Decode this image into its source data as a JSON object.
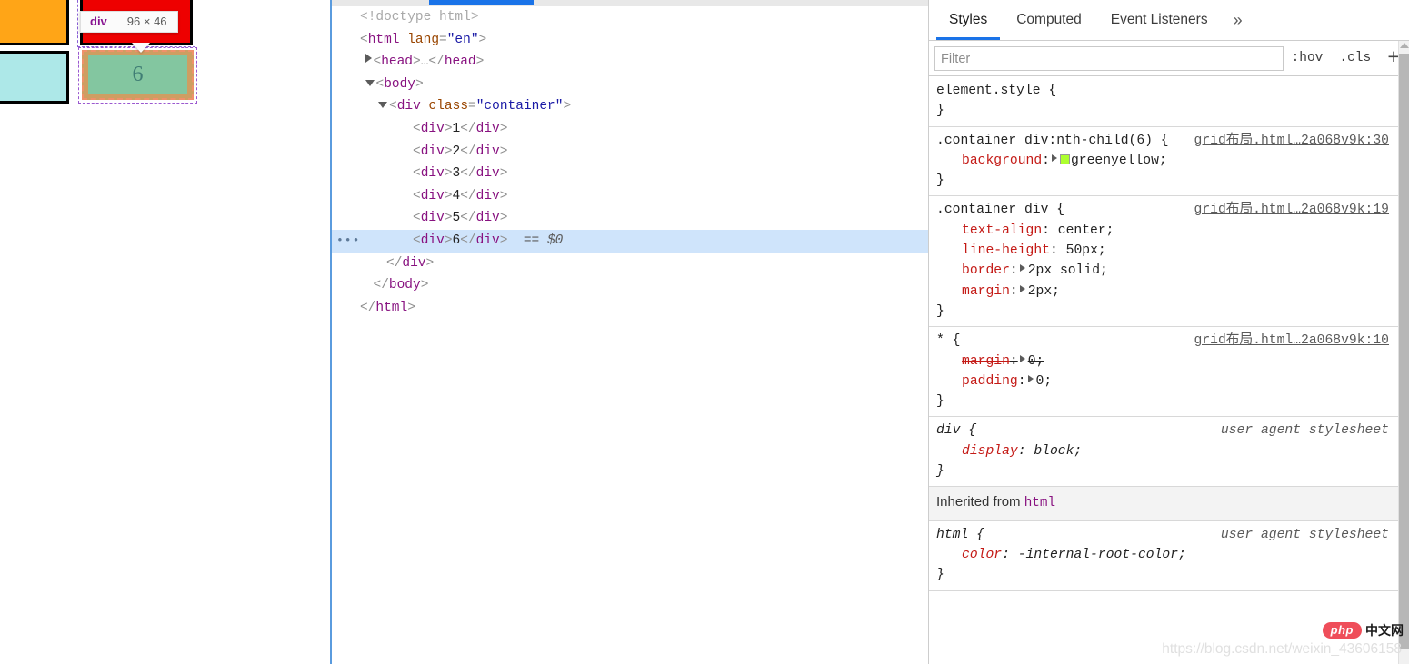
{
  "page_preview": {
    "tooltip": {
      "tag": "div",
      "dimensions": "96 × 46"
    },
    "cells": [
      {
        "label": "",
        "color": "#FFA517",
        "name": "grid-cell-orange"
      },
      {
        "label": "",
        "color": "#EE0000",
        "name": "grid-cell-red"
      },
      {
        "label": "",
        "color": "#ADE8E8",
        "name": "grid-cell-cyan"
      },
      {
        "label": "6",
        "color": "#83C6A0",
        "name": "grid-cell-six-highlighted"
      }
    ],
    "highlighted_cell_label": "6"
  },
  "dom_panel": {
    "lines": [
      {
        "indent": 0,
        "twisty": "none",
        "parts": [
          {
            "c": "g",
            "t": "<!doctype html>"
          }
        ]
      },
      {
        "indent": 0,
        "twisty": "none",
        "parts": [
          {
            "c": "br",
            "t": "<"
          },
          {
            "c": "tag",
            "t": "html"
          },
          {
            "c": "at",
            "t": " lang"
          },
          {
            "c": "br",
            "t": "="
          },
          {
            "c": "av",
            "t": "\"en\""
          },
          {
            "c": "br",
            "t": ">"
          }
        ]
      },
      {
        "indent": 1,
        "twisty": "closed",
        "parts": [
          {
            "c": "br",
            "t": "<"
          },
          {
            "c": "tag",
            "t": "head"
          },
          {
            "c": "br",
            "t": ">"
          },
          {
            "c": "g",
            "t": "…"
          },
          {
            "c": "br",
            "t": "</"
          },
          {
            "c": "tag",
            "t": "head"
          },
          {
            "c": "br",
            "t": ">"
          }
        ]
      },
      {
        "indent": 1,
        "twisty": "open",
        "parts": [
          {
            "c": "br",
            "t": "<"
          },
          {
            "c": "tag",
            "t": "body"
          },
          {
            "c": "br",
            "t": ">"
          }
        ]
      },
      {
        "indent": 2,
        "twisty": "open",
        "parts": [
          {
            "c": "br",
            "t": "<"
          },
          {
            "c": "tag",
            "t": "div"
          },
          {
            "c": "at",
            "t": " class"
          },
          {
            "c": "br",
            "t": "="
          },
          {
            "c": "av",
            "t": "\"container\""
          },
          {
            "c": "br",
            "t": ">"
          }
        ]
      },
      {
        "indent": 4,
        "twisty": "none",
        "parts": [
          {
            "c": "br",
            "t": "<"
          },
          {
            "c": "tag",
            "t": "div"
          },
          {
            "c": "br",
            "t": ">"
          },
          {
            "c": "tx",
            "t": "1"
          },
          {
            "c": "br",
            "t": "</"
          },
          {
            "c": "tag",
            "t": "div"
          },
          {
            "c": "br",
            "t": ">"
          }
        ]
      },
      {
        "indent": 4,
        "twisty": "none",
        "parts": [
          {
            "c": "br",
            "t": "<"
          },
          {
            "c": "tag",
            "t": "div"
          },
          {
            "c": "br",
            "t": ">"
          },
          {
            "c": "tx",
            "t": "2"
          },
          {
            "c": "br",
            "t": "</"
          },
          {
            "c": "tag",
            "t": "div"
          },
          {
            "c": "br",
            "t": ">"
          }
        ]
      },
      {
        "indent": 4,
        "twisty": "none",
        "parts": [
          {
            "c": "br",
            "t": "<"
          },
          {
            "c": "tag",
            "t": "div"
          },
          {
            "c": "br",
            "t": ">"
          },
          {
            "c": "tx",
            "t": "3"
          },
          {
            "c": "br",
            "t": "</"
          },
          {
            "c": "tag",
            "t": "div"
          },
          {
            "c": "br",
            "t": ">"
          }
        ]
      },
      {
        "indent": 4,
        "twisty": "none",
        "parts": [
          {
            "c": "br",
            "t": "<"
          },
          {
            "c": "tag",
            "t": "div"
          },
          {
            "c": "br",
            "t": ">"
          },
          {
            "c": "tx",
            "t": "4"
          },
          {
            "c": "br",
            "t": "</"
          },
          {
            "c": "tag",
            "t": "div"
          },
          {
            "c": "br",
            "t": ">"
          }
        ]
      },
      {
        "indent": 4,
        "twisty": "none",
        "parts": [
          {
            "c": "br",
            "t": "<"
          },
          {
            "c": "tag",
            "t": "div"
          },
          {
            "c": "br",
            "t": ">"
          },
          {
            "c": "tx",
            "t": "5"
          },
          {
            "c": "br",
            "t": "</"
          },
          {
            "c": "tag",
            "t": "div"
          },
          {
            "c": "br",
            "t": ">"
          }
        ]
      },
      {
        "indent": 4,
        "twisty": "none",
        "selected": true,
        "dots": "•••",
        "parts": [
          {
            "c": "br",
            "t": "<"
          },
          {
            "c": "tag",
            "t": "div"
          },
          {
            "c": "br",
            "t": ">"
          },
          {
            "c": "tx",
            "t": "6"
          },
          {
            "c": "br",
            "t": "</"
          },
          {
            "c": "tag",
            "t": "div"
          },
          {
            "c": "br",
            "t": ">"
          },
          {
            "c": "eq0",
            "t": "  == $0"
          }
        ]
      },
      {
        "indent": 2,
        "twisty": "none",
        "parts": [
          {
            "c": "br",
            "t": "</"
          },
          {
            "c": "tag",
            "t": "div"
          },
          {
            "c": "br",
            "t": ">"
          }
        ]
      },
      {
        "indent": 1,
        "twisty": "none",
        "parts": [
          {
            "c": "br",
            "t": "</"
          },
          {
            "c": "tag",
            "t": "body"
          },
          {
            "c": "br",
            "t": ">"
          }
        ]
      },
      {
        "indent": 0,
        "twisty": "none",
        "parts": [
          {
            "c": "br",
            "t": "</"
          },
          {
            "c": "tag",
            "t": "html"
          },
          {
            "c": "br",
            "t": ">"
          }
        ]
      }
    ]
  },
  "styles_panel": {
    "tabs": [
      {
        "label": "Styles",
        "active": true
      },
      {
        "label": "Computed",
        "active": false
      },
      {
        "label": "Event Listeners",
        "active": false
      }
    ],
    "more_tabs_glyph": "»",
    "filter": {
      "placeholder": "Filter",
      "value": ""
    },
    "toggles": {
      "hov": ":hov",
      "cls": ".cls",
      "add": "+"
    },
    "rules": [
      {
        "selector": "element.style {",
        "source": "",
        "close": "}",
        "declarations": []
      },
      {
        "selector": ".container div:nth-child(6) {",
        "source": "grid布局.html…2a068v9k:30",
        "close": "}",
        "declarations": [
          {
            "property": "background",
            "value": "greenyellow;",
            "expander": true,
            "swatch": "#adff2f",
            "struck": false
          }
        ]
      },
      {
        "selector": ".container div {",
        "source": "grid布局.html…2a068v9k:19",
        "close": "}",
        "declarations": [
          {
            "property": "text-align",
            "value": "center;",
            "expander": false,
            "struck": false
          },
          {
            "property": "line-height",
            "value": "50px;",
            "expander": false,
            "struck": false
          },
          {
            "property": "border",
            "value": "2px solid;",
            "expander": true,
            "struck": false
          },
          {
            "property": "margin",
            "value": "2px;",
            "expander": true,
            "struck": false
          }
        ]
      },
      {
        "selector": "* {",
        "source": "grid布局.html…2a068v9k:10",
        "close": "}",
        "declarations": [
          {
            "property": "margin",
            "value": "0;",
            "expander": true,
            "struck": true
          },
          {
            "property": "padding",
            "value": "0;",
            "expander": true,
            "struck": false
          }
        ]
      },
      {
        "selector": "div {",
        "source": "user agent stylesheet",
        "source_plain": true,
        "ua": true,
        "close": "}",
        "declarations": [
          {
            "property": "display",
            "value": "block;",
            "expander": false,
            "struck": false
          }
        ]
      }
    ],
    "inherited_header": {
      "prefix": "Inherited from",
      "element": "html"
    },
    "inherited_rules": [
      {
        "selector": "html {",
        "source": "user agent stylesheet",
        "source_plain": true,
        "ua": true,
        "close": "}",
        "declarations": [
          {
            "property": "color",
            "value": "-internal-root-color;",
            "expander": false,
            "struck": false
          }
        ]
      }
    ]
  },
  "watermark": {
    "logo_text": "php",
    "logo_cn": "中文网",
    "url": "https://blog.csdn.net/weixin_43606158"
  }
}
